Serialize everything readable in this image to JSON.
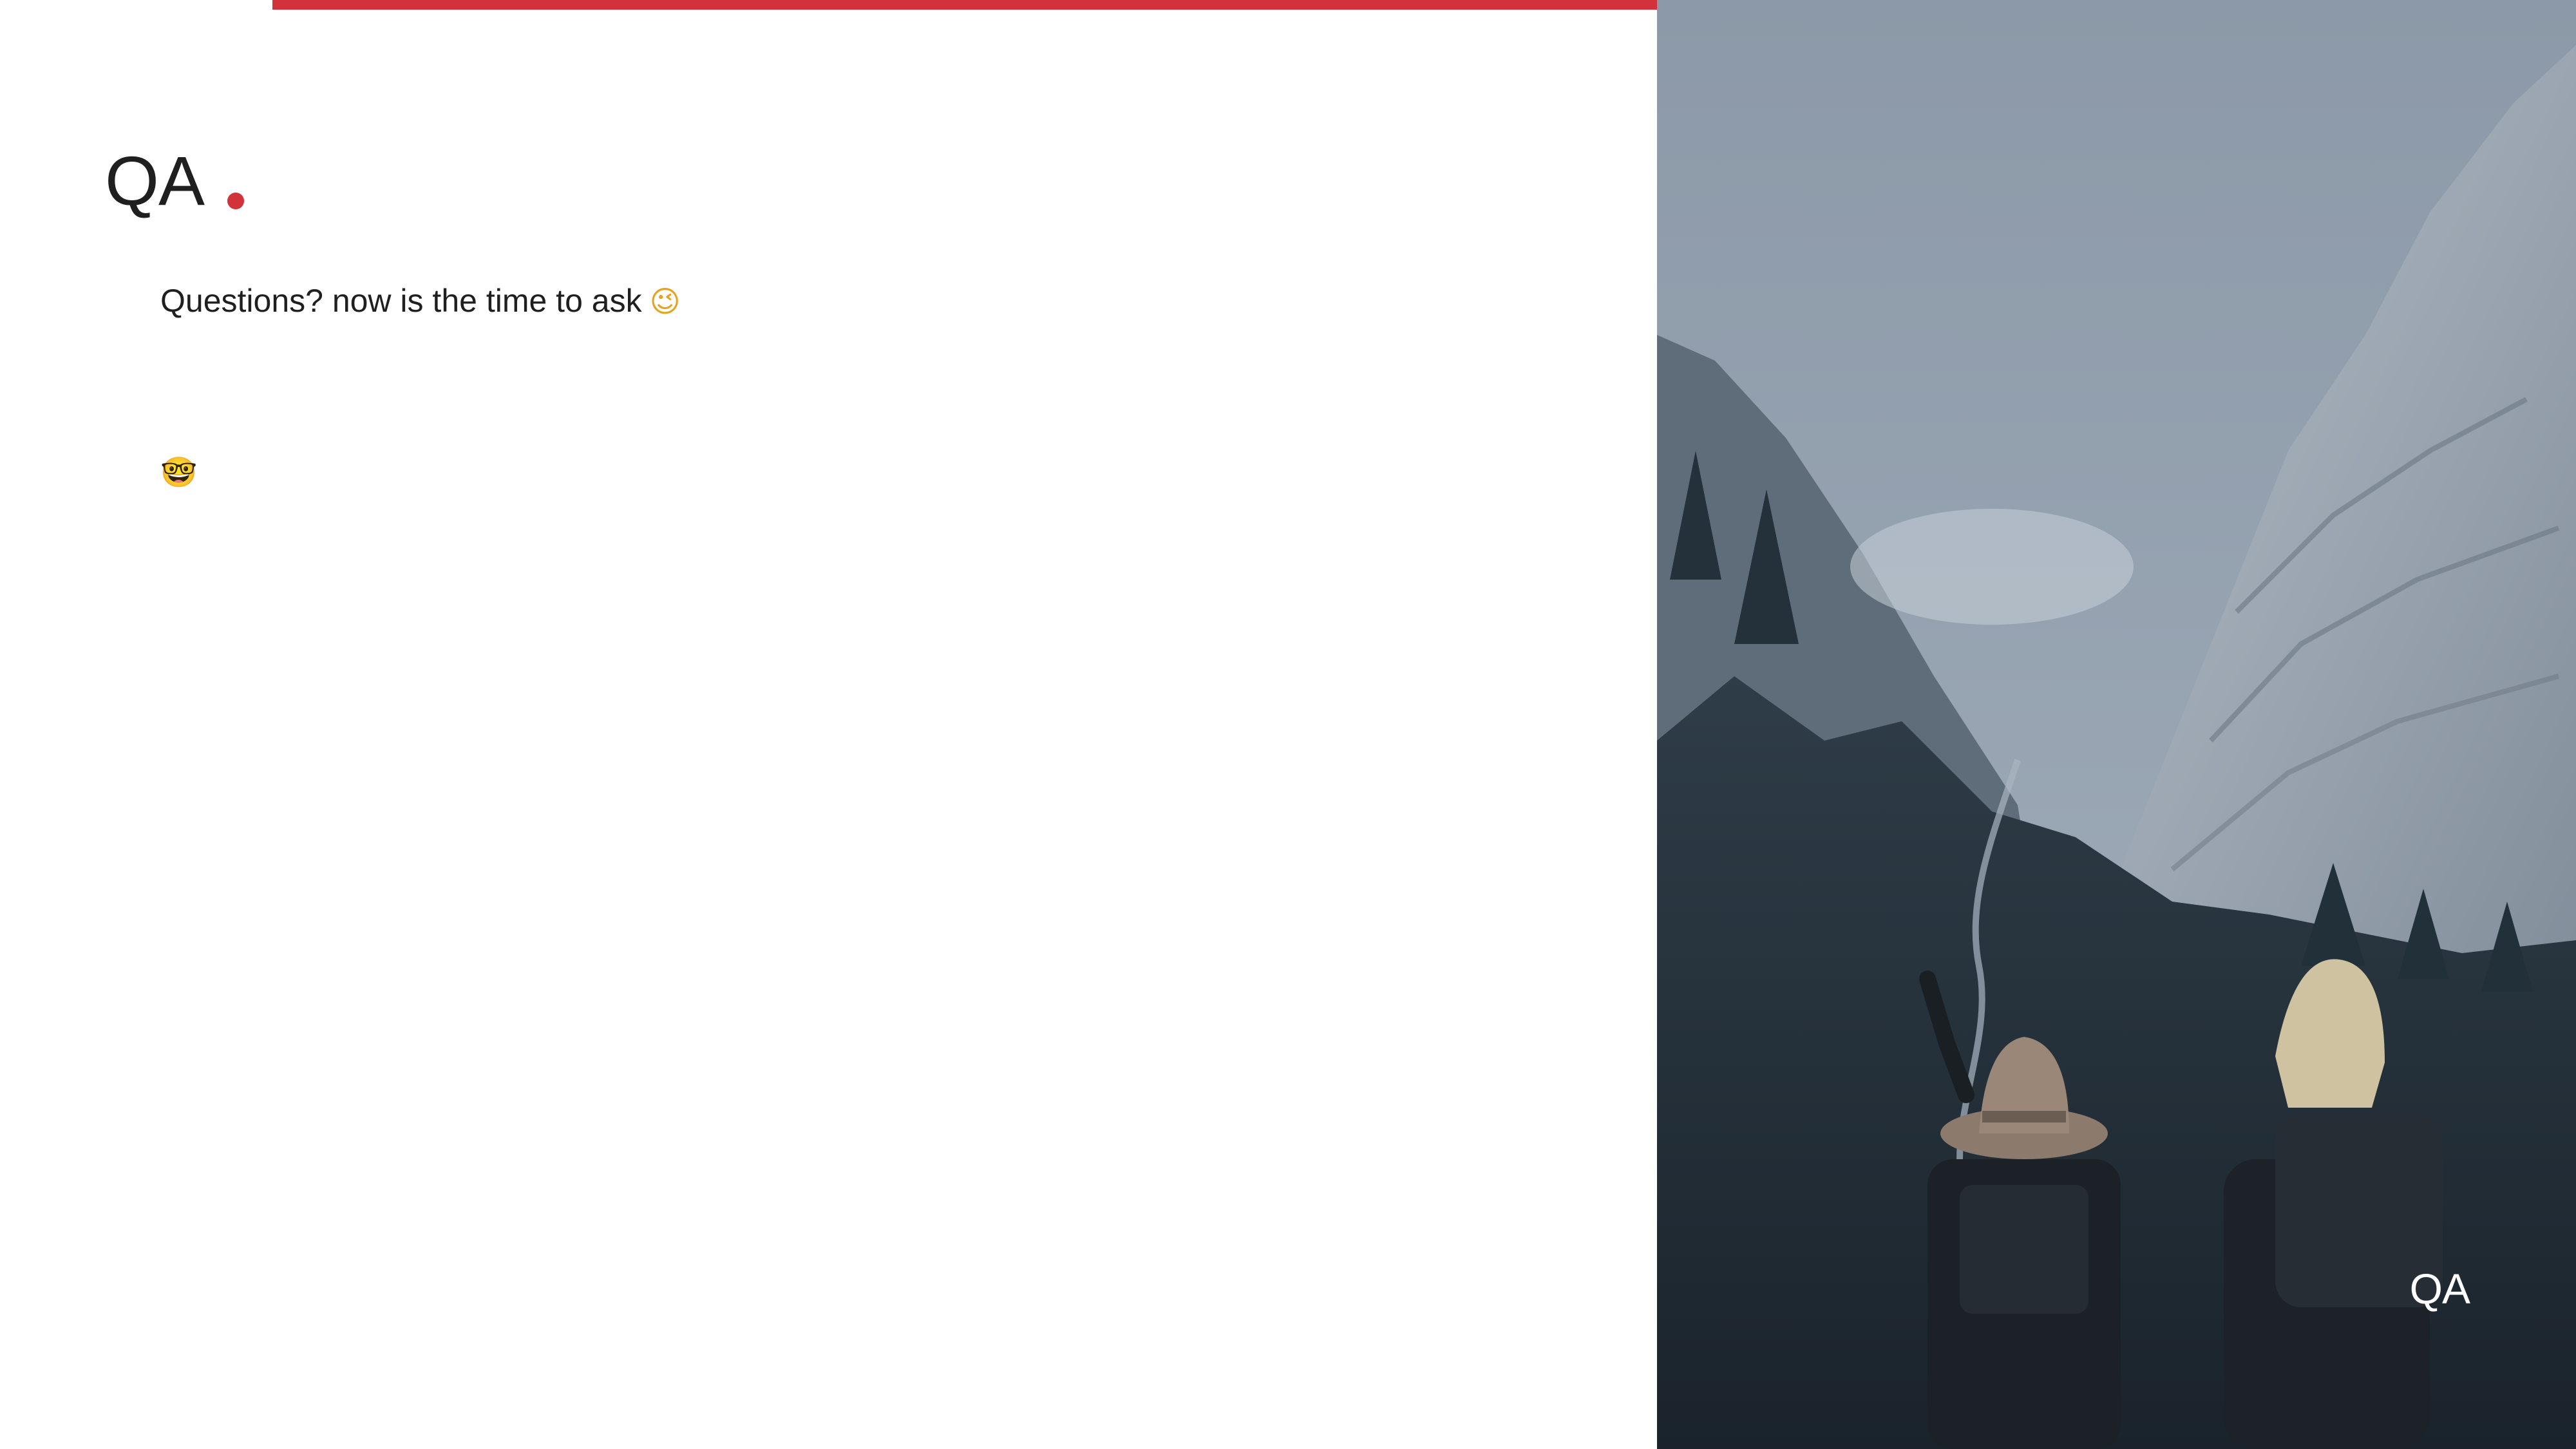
{
  "slide": {
    "title": "QA",
    "body_text": "Questions? now is the time to ask",
    "emoji_wink": "😉",
    "emoji_nerd": "🤓",
    "photo_caption": "QA"
  },
  "colors": {
    "accent": "#d2333a",
    "text": "#1f1f1f",
    "background": "#ffffff"
  },
  "icons": {
    "title_marker": "red-dot-icon",
    "wink": "winking-face-icon",
    "nerd": "nerd-face-icon"
  }
}
